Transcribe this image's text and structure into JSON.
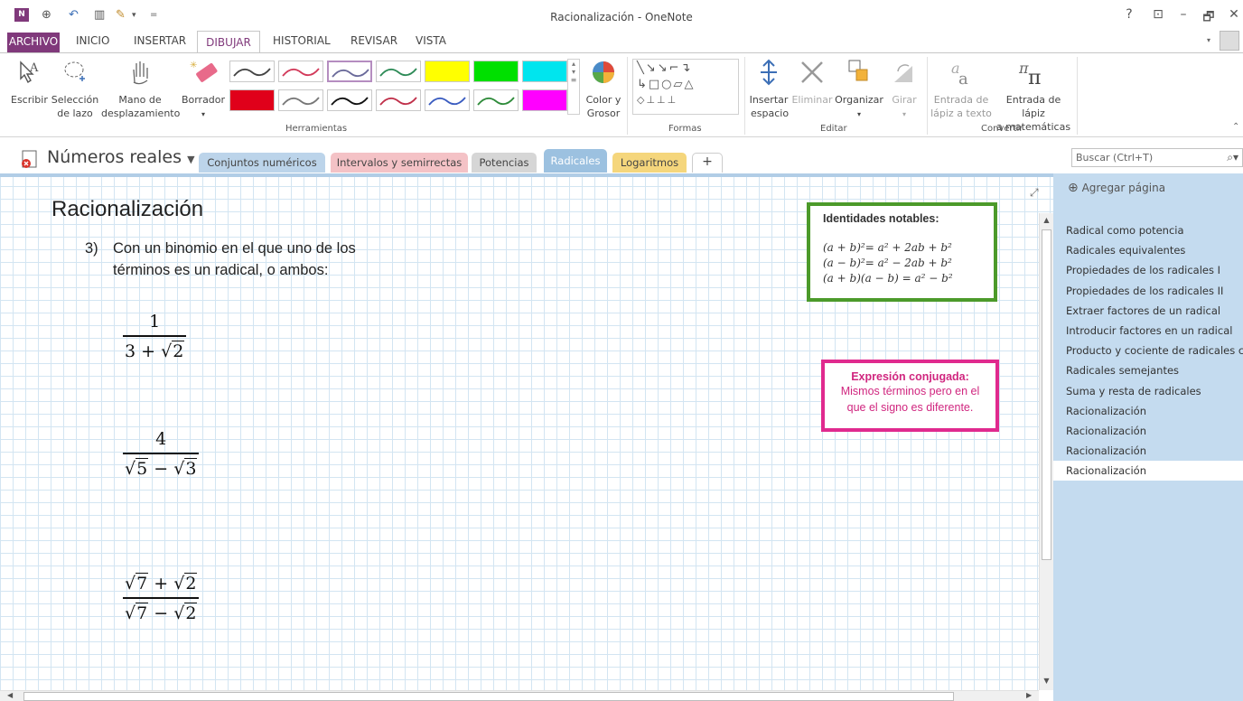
{
  "window": {
    "title": "Racionalización - OneNote",
    "help": "?",
    "minimize": "–",
    "restore": "🗗",
    "close": "✕"
  },
  "ribbon_tabs": [
    "ARCHIVO",
    "INICIO",
    "INSERTAR",
    "DIBUJAR",
    "HISTORIAL",
    "REVISAR",
    "VISTA"
  ],
  "ribbon": {
    "tools": {
      "write": "Escribir",
      "lasso_1": "Selección",
      "lasso_2": "de lazo",
      "pan_1": "Mano de",
      "pan_2": "desplazamiento",
      "eraser": "Borrador",
      "color_1": "Color y",
      "color_2": "Grosor",
      "group": "Herramientas"
    },
    "shapes_group": "Formas",
    "edit": {
      "insert_space_1": "Insertar",
      "insert_space_2": "espacio",
      "delete": "Eliminar",
      "arrange": "Organizar",
      "rotate": "Girar",
      "group": "Editar"
    },
    "convert": {
      "ink_text_1": "Entrada de",
      "ink_text_2": "lápiz a texto",
      "ink_math_1": "Entrada de lápiz",
      "ink_math_2": "a matemáticas",
      "group": "Convertir"
    },
    "pen_colors": [
      "#444444",
      "#d23a5a",
      "#6a6a9a",
      "#2e8b57",
      "#ffff00",
      "#00e000",
      "#00e5ee",
      "#e0001a",
      "#777777",
      "#111111",
      "#c0304a",
      "#3a5cc0",
      "#2e8b3a",
      "#ff00ff"
    ]
  },
  "notebook": {
    "name": "Números reales",
    "sections": [
      {
        "label": "Conjuntos numéricos",
        "color": "#bcd4ea"
      },
      {
        "label": "Intervalos y semirrectas",
        "color": "#f4c2c6"
      },
      {
        "label": "Potencias",
        "color": "#d6d6d6"
      },
      {
        "label": "Radicales",
        "color": "#9cc1e0"
      },
      {
        "label": "Logaritmos",
        "color": "#f5d67c"
      },
      {
        "label": "+",
        "color": "#ffffff"
      }
    ],
    "search_placeholder": "Buscar (Ctrl+T)"
  },
  "page": {
    "title": "Racionalización",
    "item_number": "3)",
    "item_line1": "Con un binomio en el que uno de los",
    "item_line2": "términos es un radical, o ambos:",
    "fractions": [
      {
        "num": "1",
        "den_prefix": "3 + ",
        "den_rad": "2"
      },
      {
        "num": "4",
        "den_rad_a": "5",
        "den_op": " − ",
        "den_rad_b": "3"
      },
      {
        "num_rad_a": "7",
        "num_op": " + ",
        "num_rad_b": "2",
        "den_rad_a": "7",
        "den_op": " − ",
        "den_rad_b": "2"
      }
    ],
    "identities": {
      "title": "Identidades notables:",
      "eq1": "(a + b)²= a² + 2ab + b²",
      "eq2": "(a − b)²= a² − 2ab + b²",
      "eq3": "(a + b)(a − b) = a² − b²"
    },
    "conjugate": {
      "title": "Expresión conjugada:",
      "line1": "Mismos términos pero en el",
      "line2": "que el signo es diferente."
    }
  },
  "pages_pane": {
    "add_page": "Agregar página",
    "pages": [
      "Radical como potencia",
      "Radicales equivalentes",
      "Propiedades de los radicales I",
      "Propiedades de los radicales II",
      "Extraer factores de un radical",
      "Introducir factores en un radical",
      "Producto y cociente de radicales c",
      "Radicales semejantes",
      "Suma y resta de radicales",
      "Racionalización",
      "Racionalización",
      "Racionalización",
      "Racionalización"
    ],
    "active_index": 12
  }
}
